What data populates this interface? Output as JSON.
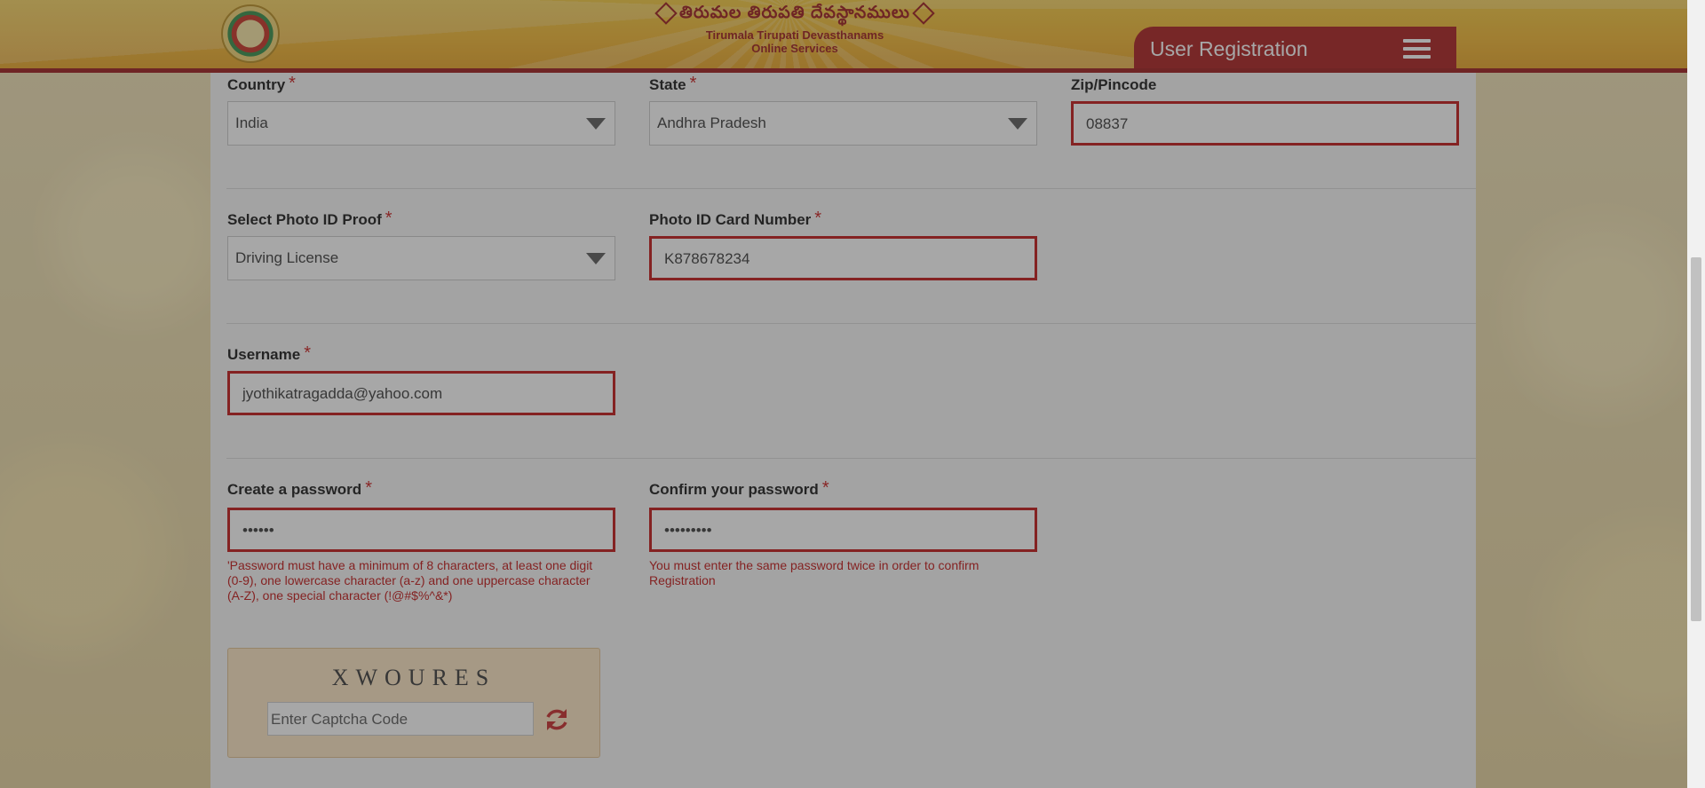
{
  "header": {
    "brand_telugu": "తిరుమల తిరుపతి దేవస్థానములు",
    "brand_line1": "Tirumala Tirupati Devasthanams",
    "brand_line2": "Online Services",
    "page_title": "User Registration",
    "menu_icon": "hamburger-menu-icon",
    "logo_icon": "ttd-logo-icon"
  },
  "colors": {
    "accent": "#a81616",
    "error": "#c00d0d",
    "header": "#f2b52b"
  },
  "form": {
    "required_marker": "*",
    "country": {
      "label": "Country",
      "value": "India"
    },
    "state": {
      "label": "State",
      "value": "Andhra Pradesh"
    },
    "zip": {
      "label": "Zip/Pincode",
      "value": "08837"
    },
    "photo_id_proof": {
      "label": "Select Photo ID Proof",
      "value": "Driving License"
    },
    "photo_id_number": {
      "label": "Photo ID Card Number",
      "value": "K878678234"
    },
    "username": {
      "label": "Username",
      "value": "jyothikatragadda@yahoo.com"
    },
    "password": {
      "label": "Create a password",
      "value": "••••••",
      "error": "'Password must have a minimum of 8 characters, at least one digit (0-9), one lowercase character (a-z) and one uppercase character (A-Z), one special character (!@#$%^&*)"
    },
    "confirm_password": {
      "label": "Confirm your password",
      "value": "•••••••••",
      "error": "You must enter the same password twice in order to confirm Registration"
    },
    "captcha": {
      "code": "XWOURES",
      "placeholder": "Enter Captcha Code",
      "refresh_icon": "refresh-icon"
    }
  }
}
